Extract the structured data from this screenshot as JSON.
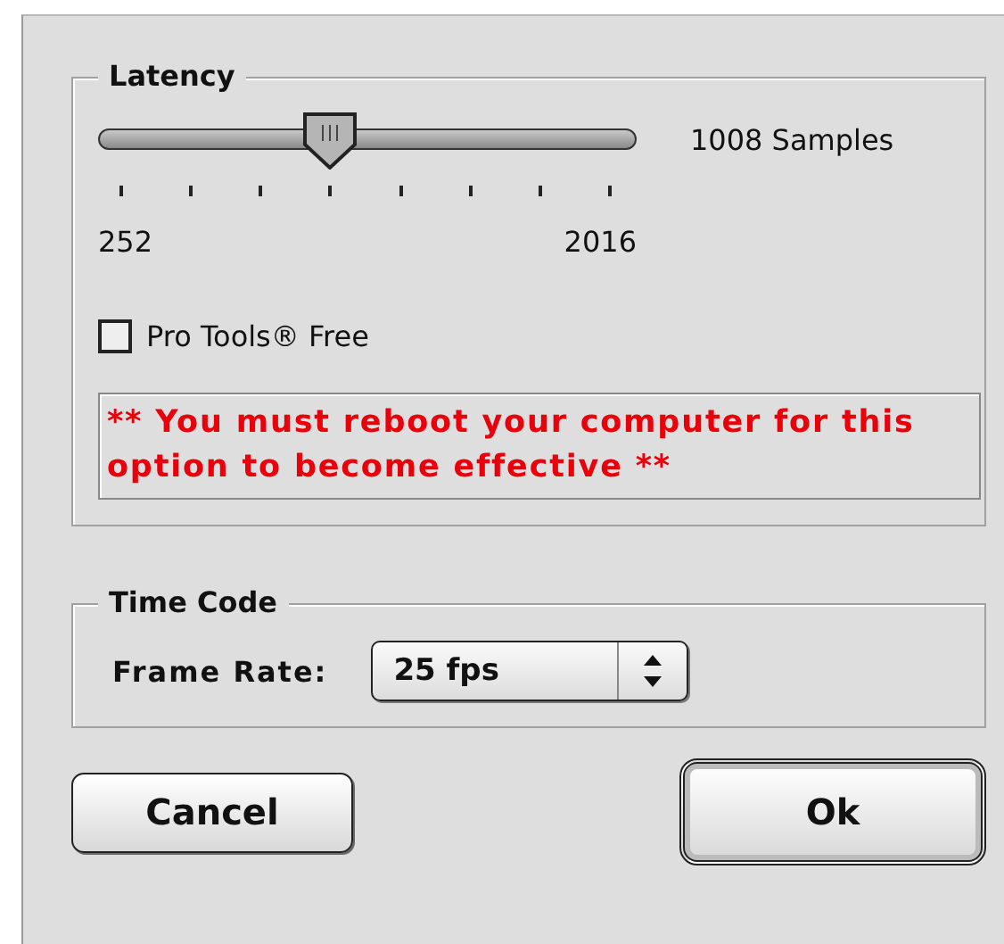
{
  "latency": {
    "title": "Latency",
    "slider": {
      "level": 0.43,
      "reading": "1008 Samples",
      "min_label": "252",
      "max_label": "2016"
    },
    "checkbox": {
      "label": "Pro Tools® Free",
      "checked": false
    },
    "warning": "** You must reboot your computer for this option to become effective **"
  },
  "time_code": {
    "title": "Time Code",
    "frame_rate": {
      "label": "Frame Rate:",
      "value": "25 fps"
    }
  },
  "buttons": [
    {
      "label": "Cancel",
      "default": false
    },
    {
      "label": "Ok",
      "default": true
    }
  ]
}
